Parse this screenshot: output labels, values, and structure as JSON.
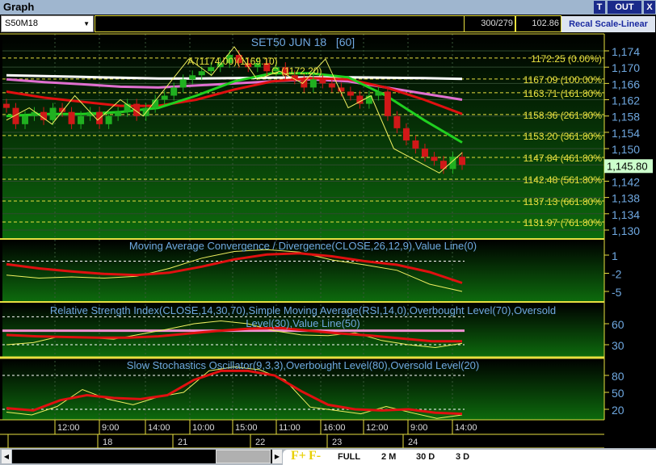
{
  "window": {
    "title": "Graph",
    "btn_t": "T",
    "btn_out": "OUT",
    "btn_x": "X"
  },
  "toolbar": {
    "symbol": "S50M18",
    "count": "300/279",
    "value": "102.86",
    "recal": "Recal Scale-Linear"
  },
  "price_panel": {
    "title": "SET50 JUN 18   [60]",
    "y_ticks": [
      "1,174",
      "1,170",
      "1,166",
      "1,162",
      "1,158",
      "1,154",
      "1,150",
      "1,146",
      "1,142",
      "1,138",
      "1,134",
      "1,130"
    ],
    "y_tick_values": [
      1174,
      1170,
      1166,
      1162,
      1158,
      1154,
      1150,
      1146,
      1142,
      1138,
      1134,
      1130
    ],
    "current_price": "1,145.80",
    "current_value": 1145.8,
    "fib": [
      {
        "v": 1172.25,
        "label": "1172.25 (0.00%)"
      },
      {
        "v": 1167.09,
        "label": "1167.09 (100.00%"
      },
      {
        "v": 1163.71,
        "label": "1163.71 (161.80%"
      },
      {
        "v": 1158.36,
        "label": "1158.36 (261.80%"
      },
      {
        "v": 1153.2,
        "label": "1153.20 (361.80%"
      },
      {
        "v": 1147.84,
        "label": "1147.84 (461.80%"
      },
      {
        "v": 1142.48,
        "label": "1142.48 (561.80%"
      },
      {
        "v": 1137.13,
        "label": "1137.13 (661.80%"
      },
      {
        "v": 1131.97,
        "label": "1131.97 (761.80%"
      }
    ],
    "annot1": "A (1174.00)(1169.10)",
    "annot2": "C (1172.20)"
  },
  "chart_data": {
    "type": "candlestick",
    "closes": [
      1160,
      1156,
      1158,
      1159,
      1157,
      1160,
      1159,
      1156,
      1158,
      1159,
      1156,
      1158,
      1159,
      1161,
      1158,
      1160,
      1162,
      1163,
      1165,
      1167,
      1168,
      1169,
      1170,
      1171,
      1173,
      1171,
      1170,
      1171,
      1169,
      1170,
      1168,
      1167,
      1165,
      1167,
      1166,
      1165,
      1164,
      1163,
      1161,
      1163,
      1164,
      1158,
      1155,
      1152,
      1150,
      1148,
      1147,
      1145,
      1148,
      1146
    ],
    "zigzag": [
      1157,
      1160,
      1156,
      1163,
      1157,
      1162,
      1158,
      1165,
      1172,
      1168,
      1175,
      1167,
      1169,
      1166,
      1172,
      1160,
      1163,
      1150,
      1147,
      1144,
      1149
    ],
    "ma_white": [
      1168,
      1167.8,
      1167.6,
      1167.4,
      1167.2,
      1167.2,
      1167.3,
      1167.4,
      1167.5,
      1167.5,
      1167.4,
      1167.3,
      1167.1
    ],
    "ma_pink": [
      1167,
      1166.3,
      1165.8,
      1165.2,
      1165,
      1165.5,
      1166,
      1166.5,
      1167,
      1166.5,
      1165,
      1163.5,
      1162
    ],
    "ma_red": [
      1164,
      1162.5,
      1161.5,
      1160.5,
      1160.5,
      1162,
      1164.5,
      1166.5,
      1167.3,
      1167,
      1165,
      1162,
      1158.5
    ],
    "ma_green": [
      1158,
      1158.5,
      1158.5,
      1159,
      1160,
      1163,
      1166.5,
      1168.5,
      1168.5,
      1167.5,
      1163,
      1157,
      1151.5
    ]
  },
  "macd": {
    "title": "Moving Average Convergence / Divergence(CLOSE,26,12,9),Value Line(0)",
    "y_ticks": [
      "1",
      "-2",
      "-5"
    ],
    "y_values": [
      1,
      -2,
      -5
    ],
    "macd": [
      -2.3,
      -2.8,
      -2.6,
      -2.8,
      -2.5,
      -1.2,
      0.5,
      1.6,
      1.9,
      1.5,
      0.2,
      -0.6,
      -1.5,
      -3.8,
      -5
    ],
    "signal": [
      -0.5,
      -1.2,
      -1.7,
      -2.1,
      -2.3,
      -1.9,
      -0.9,
      0.3,
      1.1,
      1.3,
      0.8,
      0,
      -0.6,
      -1.8,
      -3.6
    ]
  },
  "rsi": {
    "title": "Relative Strength Index(CLOSE,14,30,70),Simple Moving Average(RSI,14,0),Overbought Level(70),Oversold",
    "title2": "Level(30),Value Line(50)",
    "y_ticks": [
      "60",
      "30"
    ],
    "y_values": [
      60,
      30
    ],
    "rsi": [
      30,
      33,
      42,
      40,
      38,
      45,
      52,
      60,
      64,
      60,
      50,
      44,
      43,
      47,
      36,
      30,
      26,
      32
    ],
    "sma": [
      44,
      42,
      41,
      40,
      40,
      42,
      46,
      50,
      53,
      54,
      50,
      46,
      43,
      39,
      35,
      35
    ]
  },
  "stoch": {
    "title": "Slow Stochastics Oscillator(9,3,3),Overbought Level(80),Oversold Level(20)",
    "y_ticks": [
      "80",
      "50",
      "20"
    ],
    "y_values": [
      80,
      50,
      20
    ],
    "k": [
      15,
      10,
      25,
      55,
      38,
      28,
      42,
      50,
      88,
      95,
      90,
      72,
      24,
      18,
      12,
      25,
      14,
      4,
      10
    ],
    "d": [
      22,
      18,
      36,
      45,
      40,
      38,
      45,
      72,
      88,
      88,
      80,
      52,
      28,
      20,
      18,
      20,
      14,
      12
    ]
  },
  "time_axis": [
    "12:00",
    "9:00",
    "14:00",
    "10:00",
    "15:00",
    "11:00",
    "16:00",
    "12:00",
    "9:00",
    "14:00"
  ],
  "date_axis": [
    "18",
    "21",
    "22",
    "23",
    "24"
  ],
  "zoom": {
    "fplus": "F+",
    "fminus": "F-",
    "full": "FULL",
    "m2": "2 M",
    "d30": "30 D",
    "d3": "3 D"
  }
}
